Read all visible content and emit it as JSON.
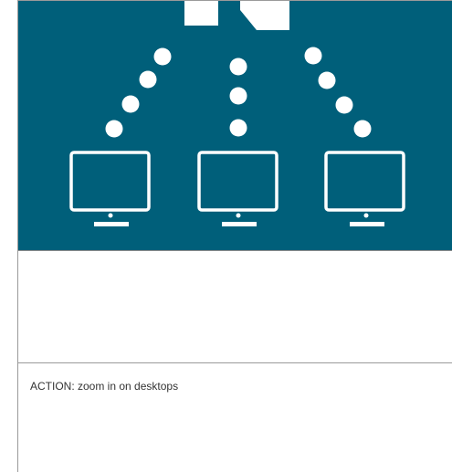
{
  "diagram": {
    "background_color": "#005f7a",
    "foreground_color": "#ffffff",
    "nodes": [
      {
        "id": "desktop-left",
        "icon": "monitor-icon"
      },
      {
        "id": "desktop-center",
        "icon": "monitor-icon"
      },
      {
        "id": "desktop-right",
        "icon": "monitor-icon"
      }
    ],
    "connectors": [
      "dotted-arc-left",
      "dotted-line-center",
      "dotted-arc-right"
    ],
    "source_icon": "server-shape-icon"
  },
  "caption": {
    "action_text": "ACTION: zoom in on desktops"
  }
}
